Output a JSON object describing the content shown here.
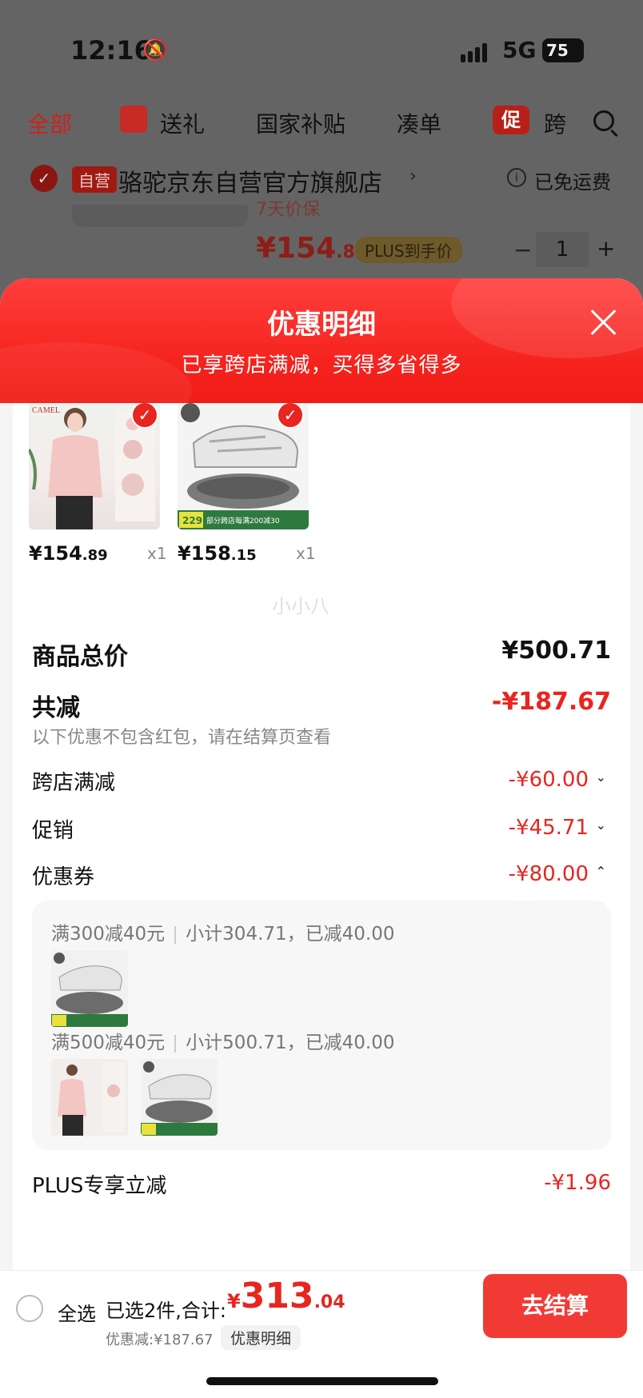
{
  "status_bar": {
    "time": "12:16",
    "network": "5G",
    "battery": "75"
  },
  "nav_tabs": [
    {
      "label": "全部",
      "active": true
    },
    {
      "label": "送礼"
    },
    {
      "label": "国家补贴"
    },
    {
      "label": "凑单"
    },
    {
      "label": "跨"
    }
  ],
  "promo_badge": "促",
  "store": {
    "badge": "自营",
    "name": "骆驼京东自营官方旗舰店",
    "arrow": "›",
    "shipping": "已免运费"
  },
  "background_item": {
    "sub": "7天价保",
    "price_int": "¥154",
    "price_dec": ".89",
    "plus_badge": "PLUS到手价",
    "qty_minus": "−",
    "qty": "1",
    "qty_plus": "+"
  },
  "sheet": {
    "title": "优惠明细",
    "subtitle": "已享跨店满减，买得多省得多"
  },
  "products": [
    {
      "price_int": "¥154",
      "price_dec": ".89",
      "qty": "x1",
      "brand": "CAMEL"
    },
    {
      "price_int": "¥158",
      "price_dec": ".15",
      "qty": "x1",
      "tag_price": "229",
      "tag_text": "部分跨店每满200减30"
    }
  ],
  "summary": {
    "total_label": "商品总价",
    "total_value": "¥500.71",
    "reduce_label": "共减",
    "reduce_value": "-¥187.67",
    "note": "以下优惠不包含红包，请在结算页查看",
    "items": [
      {
        "label": "跨店满减",
        "value": "-¥60.00",
        "chev": "⌄"
      },
      {
        "label": "促销",
        "value": "-¥45.71",
        "chev": "⌄"
      },
      {
        "label": "优惠券",
        "value": "-¥80.00",
        "chev": "⌃"
      }
    ],
    "coupons": [
      {
        "rule": "满300减40元",
        "detail": "小计304.71，已减40.00"
      },
      {
        "rule": "满500减40元",
        "detail": "小计500.71，已减40.00"
      }
    ],
    "plus_label": "PLUS专享立减",
    "plus_value": "-¥1.96"
  },
  "watermark": "小小八",
  "bottom": {
    "select_all": "全选",
    "selected_info": "已选2件,合计:",
    "total_cur": "¥",
    "total_int": "313",
    "total_dec": ".04",
    "discount": "优惠减:¥187.67",
    "detail_link": "优惠明细",
    "checkout": "去结算"
  },
  "colors": {
    "accent": "#e8251f",
    "header_red": "#f5221d"
  }
}
